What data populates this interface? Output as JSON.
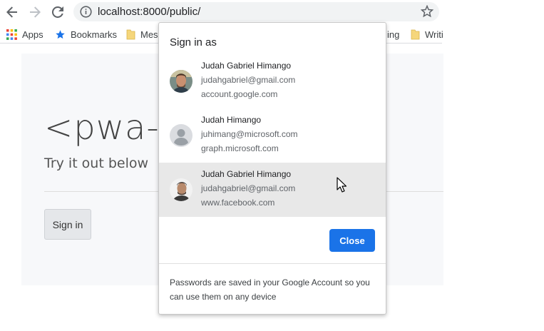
{
  "browser": {
    "url": "localhost:8000/public/",
    "bookmarks": [
      {
        "label": "Apps",
        "icon": "apps-grid-icon"
      },
      {
        "label": "Bookmarks",
        "icon": "star-icon"
      },
      {
        "label": "Mes",
        "icon": "folder-icon"
      },
      {
        "label": "ing",
        "icon": "folder-icon"
      },
      {
        "label": "Writi",
        "icon": "folder-icon"
      }
    ]
  },
  "page": {
    "title": "<pwa-a",
    "subtitle": "Try it out below",
    "signin_label": "Sign in"
  },
  "popup": {
    "title": "Sign in as",
    "accounts": [
      {
        "name": "Judah Gabriel Himango",
        "email": "judahgabriel@gmail.com",
        "origin": "account.google.com"
      },
      {
        "name": "Judah Himango",
        "email": "juhimang@microsoft.com",
        "origin": "graph.microsoft.com"
      },
      {
        "name": "Judah Gabriel Himango",
        "email": "judahgabriel@gmail.com",
        "origin": "www.facebook.com"
      }
    ],
    "close_label": "Close",
    "footer": "Passwords are saved in your Google Account so you can use them on any device"
  },
  "colors": {
    "accent": "#1a73e8",
    "hover_row": "#e8e8e8",
    "page_card": "#f7f8fa"
  }
}
